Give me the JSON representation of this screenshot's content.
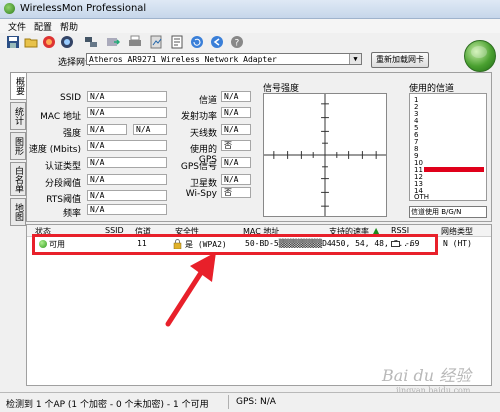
{
  "window": {
    "title": "WirelessMon Professional"
  },
  "menu": [
    "文件",
    "配置",
    "帮助"
  ],
  "toolbar_icons": [
    "save-icon",
    "open-folder-icon",
    "record-icon",
    "view-icon",
    "network-icon",
    "export-icon",
    "print-icon",
    "doc-icon",
    "refresh-icon",
    "back-icon",
    "forward-icon",
    "help-icon"
  ],
  "adapter": {
    "label": "选择网卡",
    "value": "Atheros AR9271 Wireless Network Adapter",
    "reload_label": "重新加载网卡"
  },
  "sidetabs": [
    "概要",
    "统计",
    "图形",
    "白名单",
    "地图"
  ],
  "fields_left": [
    {
      "label": "SSID",
      "value": "N/A"
    },
    {
      "label": "MAC 地址",
      "value": "N/A"
    },
    {
      "label": "强度",
      "value": "N/A",
      "value2": "N/A"
    },
    {
      "label": "速度 (Mbits)",
      "value": "N/A"
    },
    {
      "label": "认证类型",
      "value": "N/A"
    },
    {
      "label": "分段阈值",
      "value": "N/A"
    },
    {
      "label": "RTS阈值",
      "value": "N/A"
    },
    {
      "label": "频率",
      "value": "N/A"
    }
  ],
  "fields_mid": [
    {
      "label": "信道",
      "value": "N/A"
    },
    {
      "label": "发射功率",
      "value": "N/A"
    },
    {
      "label": "天线数",
      "value": "N/A"
    },
    {
      "label": "使用的GPS",
      "value": "否"
    },
    {
      "label": "GPS信号",
      "value": "N/A"
    },
    {
      "label": "卫星数",
      "value": "N/A"
    },
    {
      "label": "Wi-Spy",
      "value": "否"
    }
  ],
  "radar": {
    "label": "信号强度"
  },
  "channels": {
    "label": "使用的信道",
    "numbers": [
      "1",
      "2",
      "3",
      "4",
      "5",
      "6",
      "7",
      "8",
      "9",
      "10",
      "11",
      "12",
      "13",
      "14",
      "OTH"
    ],
    "active": "11",
    "select_value": "信道使用 B/G/N"
  },
  "table": {
    "headers": [
      "状态",
      "SSID",
      "信道",
      "安全性",
      "MAC 地址",
      "支持的速率",
      "RSSI",
      "网络类型"
    ],
    "rows": [
      {
        "status": "可用",
        "ssid": "",
        "channel": "11",
        "security": "是 (WPA2)",
        "mac": "50-BD-5▒▒▒▒▒▒▒▒▒D4",
        "rates": "450, 54, 48, 3...",
        "rssi": "-69",
        "type": "N (HT)"
      }
    ]
  },
  "status": {
    "ap": "检测到 1 个AP (1 个加密 - 0 个未加密) - 1 个可用",
    "gps": "GPS: N/A"
  },
  "watermark": {
    "brand": "Bai du 经验",
    "url": "jingyan.baidu.com"
  },
  "colors": {
    "highlight": "#e8202a",
    "channel_bar": "#e0001a"
  }
}
